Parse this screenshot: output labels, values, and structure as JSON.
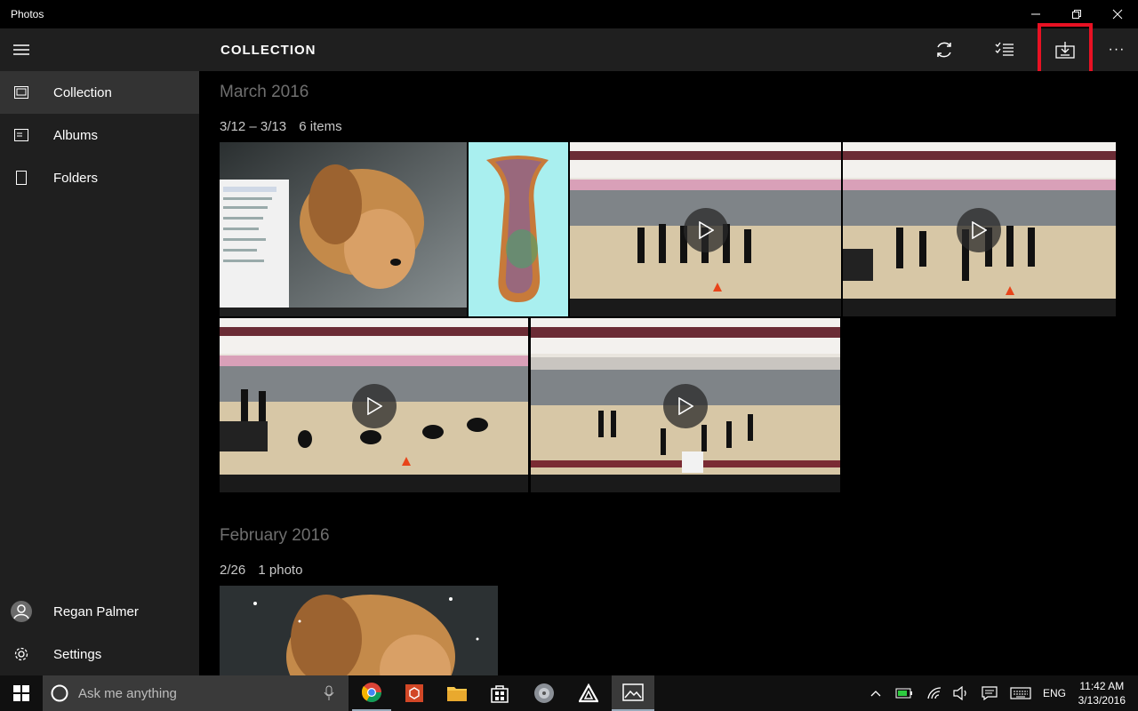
{
  "window": {
    "title": "Photos",
    "minimize": "—",
    "restore": "❐",
    "close": "✕"
  },
  "sidebar": {
    "items": [
      {
        "label": "Collection",
        "icon": "collection-icon"
      },
      {
        "label": "Albums",
        "icon": "albums-icon"
      },
      {
        "label": "Folders",
        "icon": "folders-icon"
      }
    ],
    "user": "Regan Palmer",
    "settings": "Settings"
  },
  "header": {
    "title": "COLLECTION",
    "more": "···"
  },
  "sections": [
    {
      "month": "March 2016",
      "group_date": "3/12 – 3/13",
      "group_count": "6 items"
    },
    {
      "month": "February 2016",
      "group_date": "2/26",
      "group_count": "1 photo"
    }
  ],
  "taskbar": {
    "search_placeholder": "Ask me anything",
    "language": "ENG",
    "time": "11:42 AM",
    "date": "3/13/2016"
  },
  "colors": {
    "accent_highlight": "#e81123",
    "sidebar_bg": "#1f1f1f",
    "active_item_bg": "#333333"
  }
}
